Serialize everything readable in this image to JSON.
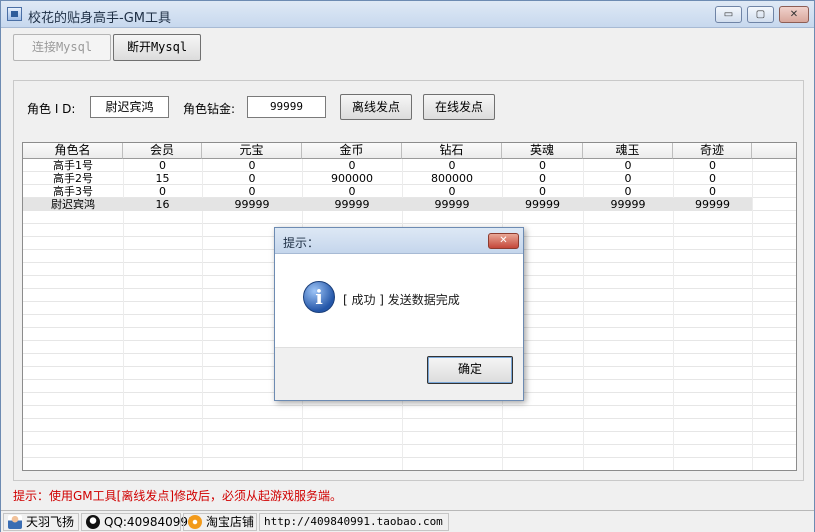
{
  "window": {
    "title": "校花的贴身高手-GM工具",
    "controls": {
      "minimize": "▭",
      "maximize": "▢",
      "close": "✕"
    }
  },
  "toolbar": {
    "connect_label": "连接Mysql",
    "disconnect_label": "断开Mysql"
  },
  "form": {
    "role_id_label": "角色 I D:",
    "role_id_value": "尉迟宾鸿",
    "diamond_label": "角色钻金:",
    "diamond_value": "99999",
    "offline_label": "离线发点",
    "online_label": "在线发点"
  },
  "table": {
    "columns": [
      "角色名",
      "会员",
      "元宝",
      "金币",
      "钻石",
      "英魂",
      "魂玉",
      "奇迹"
    ],
    "rows": [
      [
        "高手1号",
        "0",
        "0",
        "0",
        "0",
        "0",
        "0",
        "0"
      ],
      [
        "高手2号",
        "15",
        "0",
        "900000",
        "800000",
        "0",
        "0",
        "0"
      ],
      [
        "高手3号",
        "0",
        "0",
        "0",
        "0",
        "0",
        "0",
        "0"
      ],
      [
        "尉迟宾鸿",
        "16",
        "99999",
        "99999",
        "99999",
        "99999",
        "99999",
        "99999"
      ]
    ],
    "selected_row": 3
  },
  "hint": "提示：使用GM工具[离线发点]修改后，必须从起游戏服务端。",
  "statusbar": {
    "brand": "天羽飞扬",
    "qq": "QQ:409840991",
    "shop": "淘宝店铺",
    "url": "http://409840991.taobao.com"
  },
  "dialog": {
    "title": "提示：",
    "close": "✕",
    "icon_glyph": "i",
    "message": "[ 成功 ] 发送数据完成",
    "ok_label": "确定"
  }
}
